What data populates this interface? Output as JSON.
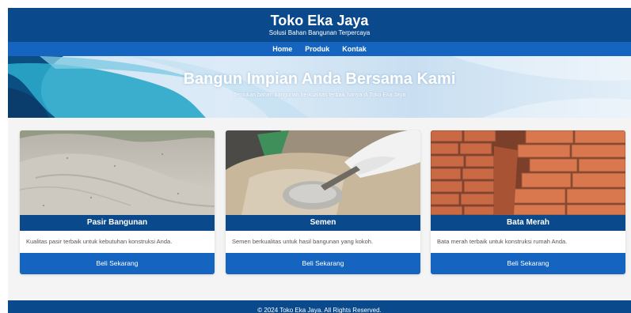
{
  "header": {
    "title": "Toko Eka Jaya",
    "tagline": "Solusi Bahan Bangunan Terpercaya"
  },
  "nav": {
    "items": [
      {
        "label": "Home"
      },
      {
        "label": "Produk"
      },
      {
        "label": "Kontak"
      }
    ]
  },
  "hero": {
    "title": "Bangun Impian Anda Bersama Kami",
    "subtitle": "Temukan bahan bangunan berkualitas terbaik hanya di Toko Eka Jaya"
  },
  "products": [
    {
      "name": "Pasir Bangunan",
      "description": "Kualitas pasir terbaik untuk kebutuhan konstruksi Anda.",
      "button_label": "Beli Sekarang"
    },
    {
      "name": "Semen",
      "description": "Semen berkualitas untuk hasil bangunan yang kokoh.",
      "button_label": "Beli Sekarang"
    },
    {
      "name": "Bata Merah",
      "description": "Bata merah terbaik untuk konstruksi rumah Anda.",
      "button_label": "Beli Sekarang"
    }
  ],
  "footer": {
    "text": "© 2024 Toko Eka Jaya. All Rights Reserved."
  },
  "colors": {
    "primary_dark": "#0a4a8c",
    "primary": "#1565c0",
    "background": "#f4f4f4"
  }
}
